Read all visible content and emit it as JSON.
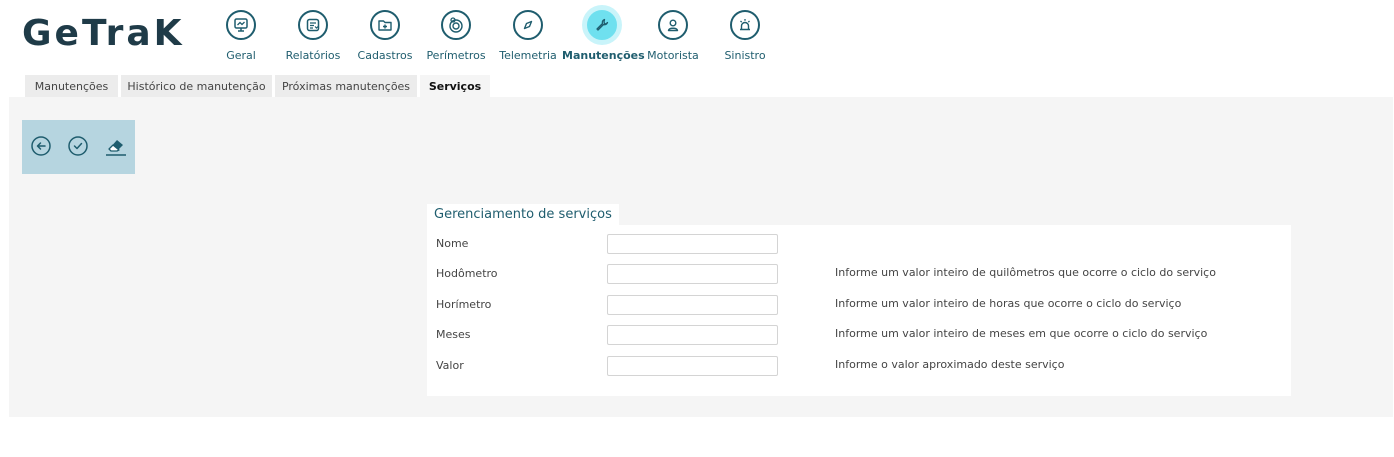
{
  "brand": {
    "logo_text": "GeTraK",
    "color": "#1f3b48",
    "accent": "#6fe0ef"
  },
  "nav": [
    {
      "id": "geral",
      "label": "Geral",
      "icon": "monitor-chart-icon",
      "active": false
    },
    {
      "id": "relatorios",
      "label": "Relatórios",
      "icon": "report-icon",
      "active": false
    },
    {
      "id": "cadastros",
      "label": "Cadastros",
      "icon": "folder-plus-icon",
      "active": false
    },
    {
      "id": "perimetros",
      "label": "Perímetros",
      "icon": "target-pin-icon",
      "active": false
    },
    {
      "id": "telemetria",
      "label": "Telemetria",
      "icon": "compass-icon",
      "active": false
    },
    {
      "id": "manutencoes",
      "label": "Manutenções",
      "icon": "wrench-icon",
      "active": true
    },
    {
      "id": "motorista",
      "label": "Motorista",
      "icon": "driver-icon",
      "active": false
    },
    {
      "id": "sinistro",
      "label": "Sinistro",
      "icon": "siren-icon",
      "active": false
    }
  ],
  "subtabs": [
    {
      "label": "Manutenções",
      "active": false
    },
    {
      "label": "Histórico de manutenção",
      "active": false
    },
    {
      "label": "Próximas manutenções",
      "active": false
    },
    {
      "label": "Serviços",
      "active": true
    }
  ],
  "toolbar": {
    "back": "arrow-left-circle-icon",
    "save": "check-circle-icon",
    "clear": "eraser-icon"
  },
  "form": {
    "title": "Gerenciamento de serviços",
    "fields": [
      {
        "label": "Nome",
        "value": "",
        "hint": ""
      },
      {
        "label": "Hodômetro",
        "value": "",
        "hint": "Informe um valor inteiro de quilômetros que ocorre o ciclo do serviço"
      },
      {
        "label": "Horímetro",
        "value": "",
        "hint": "Informe um valor inteiro de horas que ocorre o ciclo do serviço"
      },
      {
        "label": "Meses",
        "value": "",
        "hint": "Informe um valor inteiro de meses em que ocorre o ciclo do serviço"
      },
      {
        "label": "Valor",
        "value": "",
        "hint": "Informe o valor aproximado deste serviço"
      }
    ]
  }
}
